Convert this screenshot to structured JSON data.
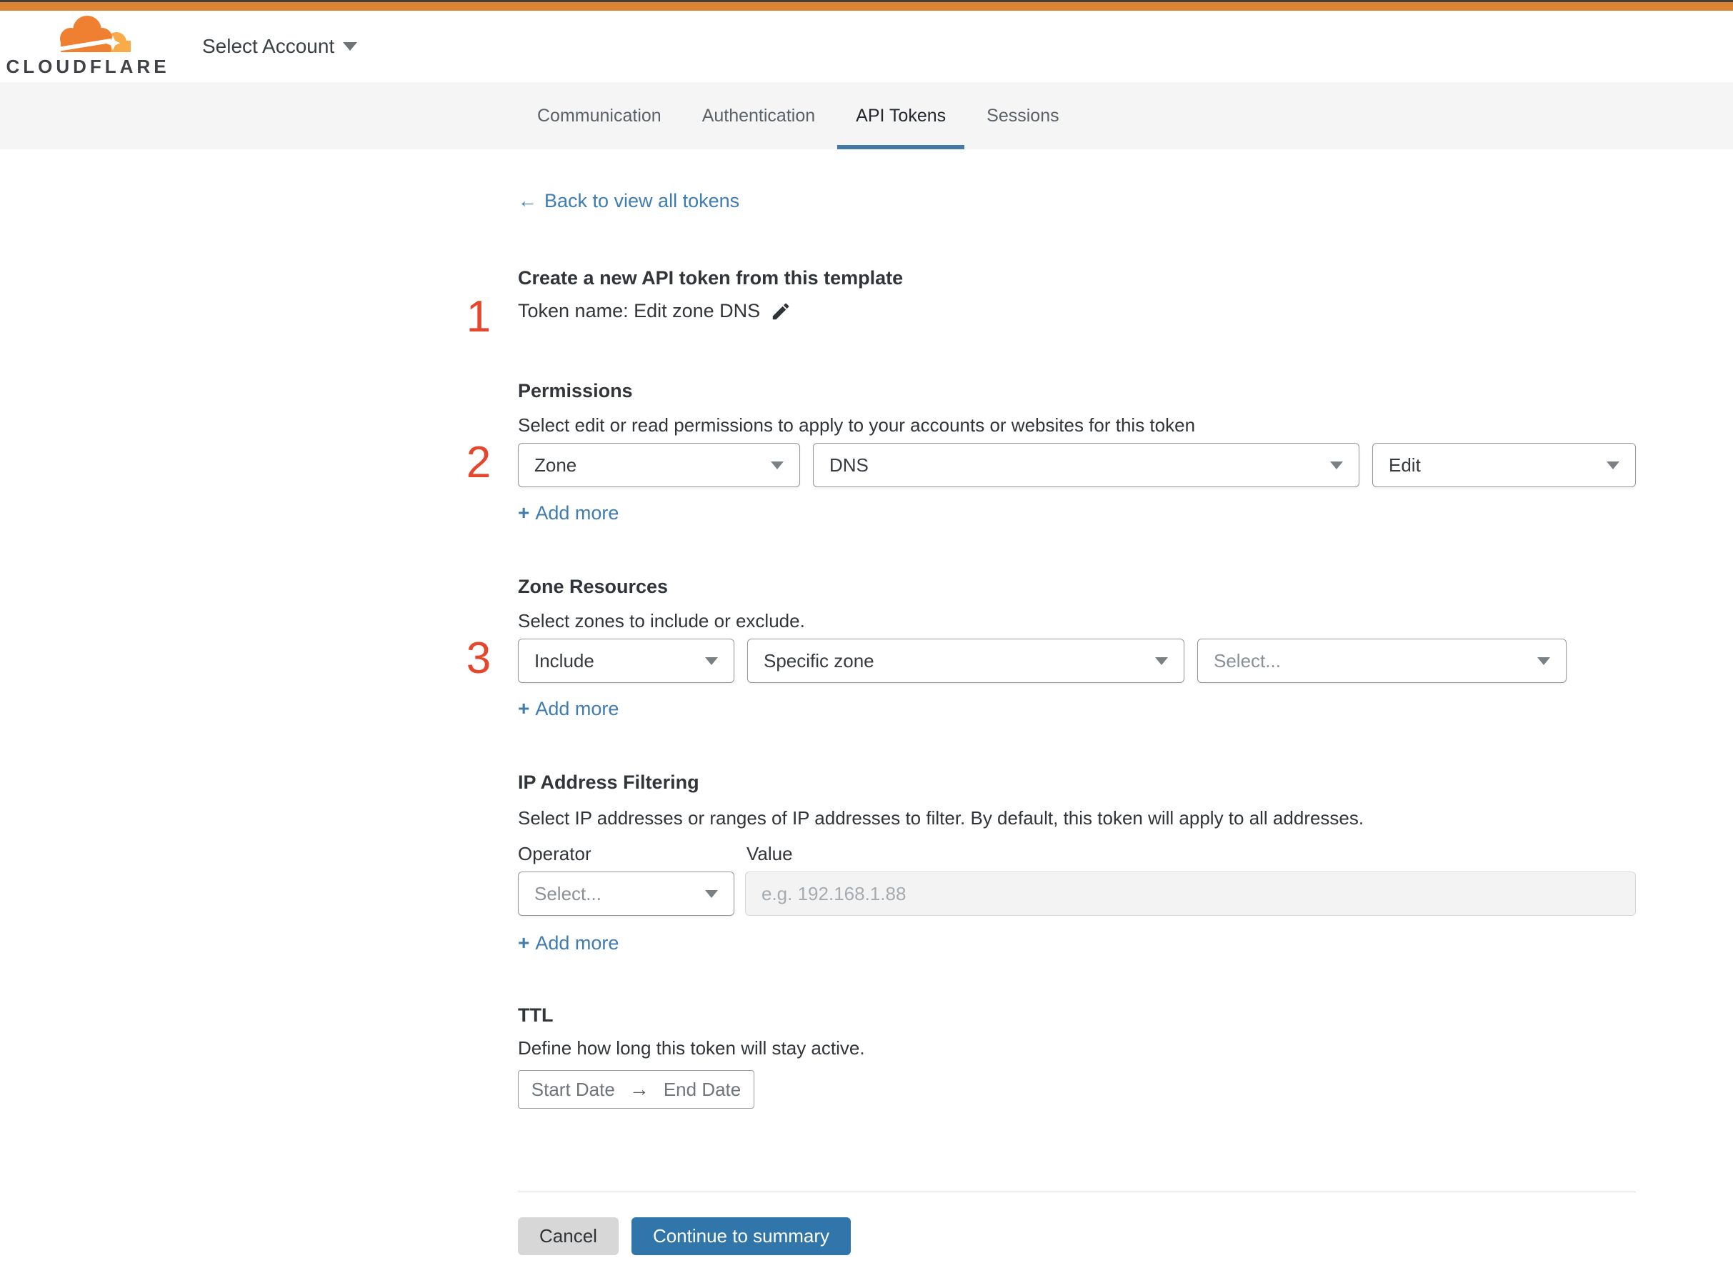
{
  "header": {
    "logo_text": "CLOUDFLARE",
    "account_selector": "Select Account"
  },
  "tabs": {
    "items": [
      {
        "label": "Communication",
        "active": false
      },
      {
        "label": "Authentication",
        "active": false
      },
      {
        "label": "API Tokens",
        "active": true
      },
      {
        "label": "Sessions",
        "active": false
      }
    ]
  },
  "back": {
    "arrow": "←",
    "label": "Back to view all tokens"
  },
  "labels": {
    "plus": "+",
    "add_more": "Add more"
  },
  "sections": {
    "template": {
      "number": "1",
      "title": "Create a new API token from this template",
      "token_name_line": "Token name: Edit zone DNS"
    },
    "permissions": {
      "number": "2",
      "title": "Permissions",
      "description": "Select edit or read permissions to apply to your accounts or websites for this token",
      "dropdowns": [
        "Zone",
        "DNS",
        "Edit"
      ]
    },
    "zone_resources": {
      "number": "3",
      "title": "Zone Resources",
      "description": "Select zones to include or exclude.",
      "dropdowns": [
        "Include",
        "Specific zone"
      ],
      "zone_placeholder": "Select..."
    },
    "ip_filtering": {
      "title": "IP Address Filtering",
      "description": "Select IP addresses or ranges of IP addresses to filter. By default, this token will apply to all addresses.",
      "operator_label": "Operator",
      "value_label": "Value",
      "operator_placeholder": "Select...",
      "value_placeholder": "e.g. 192.168.1.88"
    },
    "ttl": {
      "title": "TTL",
      "description": "Define how long this token will stay active.",
      "start_date": "Start Date",
      "range_arrow": "→",
      "end_date": "End Date"
    }
  },
  "footer": {
    "cancel": "Cancel",
    "continue": "Continue to summary"
  },
  "colors": {
    "accent_bar_orange": "#dd8434",
    "logo_orange": "#ef8032",
    "logo_light_orange": "#f9ab49",
    "link_blue": "#3e7cb1",
    "tab_underline_blue": "#4579a9",
    "step_number_red": "#e6462c",
    "primary_button_blue": "#3076ab",
    "cancel_button_gray": "#d7d7d8"
  }
}
